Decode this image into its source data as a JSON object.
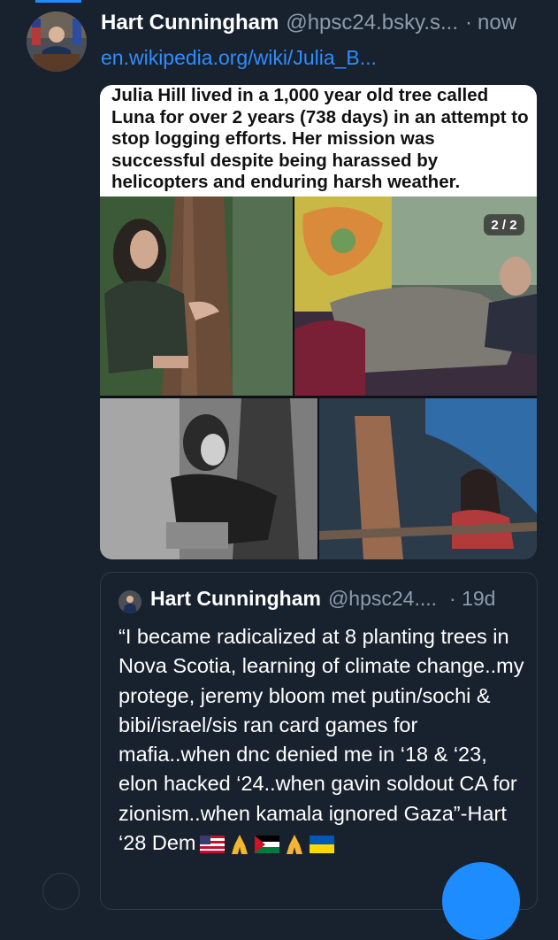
{
  "post": {
    "author_name": "Hart Cunningham",
    "author_handle": "@hpsc24.bsky.s...",
    "separator": "·",
    "time": "now",
    "link": "en.wikipedia.org/wiki/Julia_B..."
  },
  "media": {
    "caption": "Julia Hill lived in a 1,000 year old tree called Luna for over 2 years (738 days) in an attempt to stop logging efforts. Her mission was successful despite being harassed by helicopters and enduring harsh weather.",
    "counter": "2 / 2"
  },
  "quote": {
    "author_name": "Hart Cunningham",
    "author_handle": "@hpsc24....",
    "time": "· 19d",
    "text": "“I became radicalized at 8 planting trees in Nova Scotia, learning of climate change..my protege, jeremy bloom met putin/sochi & bibi/israel/sis ran card games for mafia..when dnc denied me in ‘18 & ‘23, elon hacked ‘24..when gavin soldout CA for zionism..when kamala ignored Gaza”-Hart ‘28 Dem"
  },
  "colors": {
    "background": "#18222f",
    "link": "#2f8cff",
    "muted": "#8e9bab",
    "accent": "#1d8cff"
  },
  "icons": [
    "us-flag-icon",
    "praying-hands-icon",
    "palestine-flag-icon",
    "praying-hands-icon",
    "ukraine-flag-icon"
  ]
}
